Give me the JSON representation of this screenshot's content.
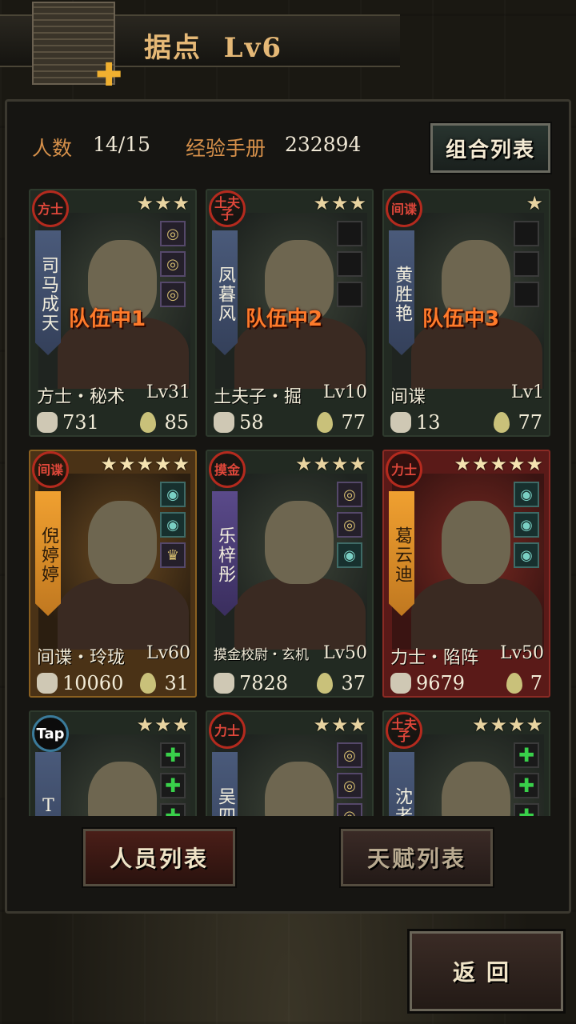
{
  "header": {
    "title": "据点  Lv6"
  },
  "stats": {
    "count_label": "人数",
    "count_value": "14/15",
    "exp_label": "经验手册",
    "exp_value": "232894"
  },
  "combo_button": "组合列表",
  "cards": [
    {
      "class": "方士",
      "stars": "★★★",
      "name": "司马成天",
      "team": "队伍中1",
      "role": "方士・秘术",
      "level": "Lv31",
      "power": "731",
      "stamina": "85",
      "equip": [
        "ring",
        "ring",
        "ring"
      ],
      "style": "normal",
      "banner": "blue"
    },
    {
      "class": "土夫子",
      "stars": "★★★",
      "name": "凤暮风",
      "team": "队伍中2",
      "role": "土夫子・掘",
      "level": "Lv10",
      "power": "58",
      "stamina": "77",
      "equip": [
        "empty",
        "empty",
        "empty"
      ],
      "style": "normal",
      "banner": "blue"
    },
    {
      "class": "间谍",
      "stars": "★",
      "name": "黄胜艳",
      "team": "队伍中3",
      "role": "间谍",
      "level": "Lv1",
      "power": "13",
      "stamina": "77",
      "equip": [
        "empty",
        "empty",
        "empty"
      ],
      "style": "normal",
      "banner": "blue"
    },
    {
      "class": "间谍",
      "stars": "★★★★★",
      "name": "倪婷婷",
      "team": "",
      "role": "间谍・玲珑",
      "level": "Lv60",
      "power": "10060",
      "stamina": "31",
      "equip": [
        "teal",
        "teal",
        "gold"
      ],
      "style": "gold",
      "banner": "orange"
    },
    {
      "class": "摸金",
      "stars": "★★★★",
      "name": "乐梓彤",
      "team": "",
      "role": "摸金校尉・玄机",
      "level": "Lv50",
      "power": "7828",
      "stamina": "37",
      "equip": [
        "ring",
        "ring",
        "teal"
      ],
      "style": "normal",
      "banner": "purple"
    },
    {
      "class": "力士",
      "stars": "★★★★★",
      "name": "葛云迪",
      "team": "",
      "role": "力士・陷阵",
      "level": "Lv50",
      "power": "9679",
      "stamina": "7",
      "equip": [
        "teal",
        "teal",
        "teal"
      ],
      "style": "red",
      "banner": "orange"
    },
    {
      "class": "Tap",
      "stars": "★★★",
      "name": "T酱",
      "team": "",
      "role": "",
      "level": "",
      "power": "",
      "stamina": "",
      "equip": [
        "plus",
        "plus",
        "plus"
      ],
      "style": "normal",
      "banner": "blue"
    },
    {
      "class": "力士",
      "stars": "★★★",
      "name": "吴四昊",
      "team": "",
      "role": "",
      "level": "",
      "power": "",
      "stamina": "",
      "equip": [
        "ring",
        "ring",
        "ring"
      ],
      "style": "normal",
      "banner": "blue"
    },
    {
      "class": "土夫子",
      "stars": "★★★★",
      "name": "沈老二",
      "team": "",
      "role": "",
      "level": "",
      "power": "",
      "stamina": "",
      "equip": [
        "plus",
        "plus",
        "plus"
      ],
      "style": "normal",
      "banner": "blue"
    }
  ],
  "tabs": {
    "personnel": "人员列表",
    "talent": "天赋列表"
  },
  "back_button": "返回"
}
